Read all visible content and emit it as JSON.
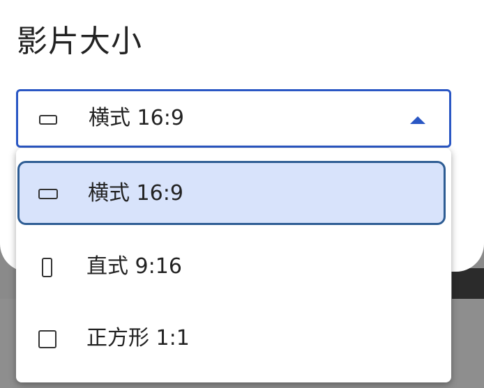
{
  "dialog": {
    "title": "影片大小"
  },
  "select": {
    "value": "横式 16:9",
    "icon": "landscape-icon",
    "accent_color": "#2a57c4",
    "expanded": true
  },
  "menu": {
    "items": [
      {
        "label": "横式 16:9",
        "icon": "landscape-icon",
        "selected": true
      },
      {
        "label": "直式 9:16",
        "icon": "portrait-icon",
        "selected": false
      },
      {
        "label": "正方形 1:1",
        "icon": "square-icon",
        "selected": false
      }
    ],
    "selected_bg": "#d8e3fb",
    "selected_border": "#2d5c93"
  }
}
